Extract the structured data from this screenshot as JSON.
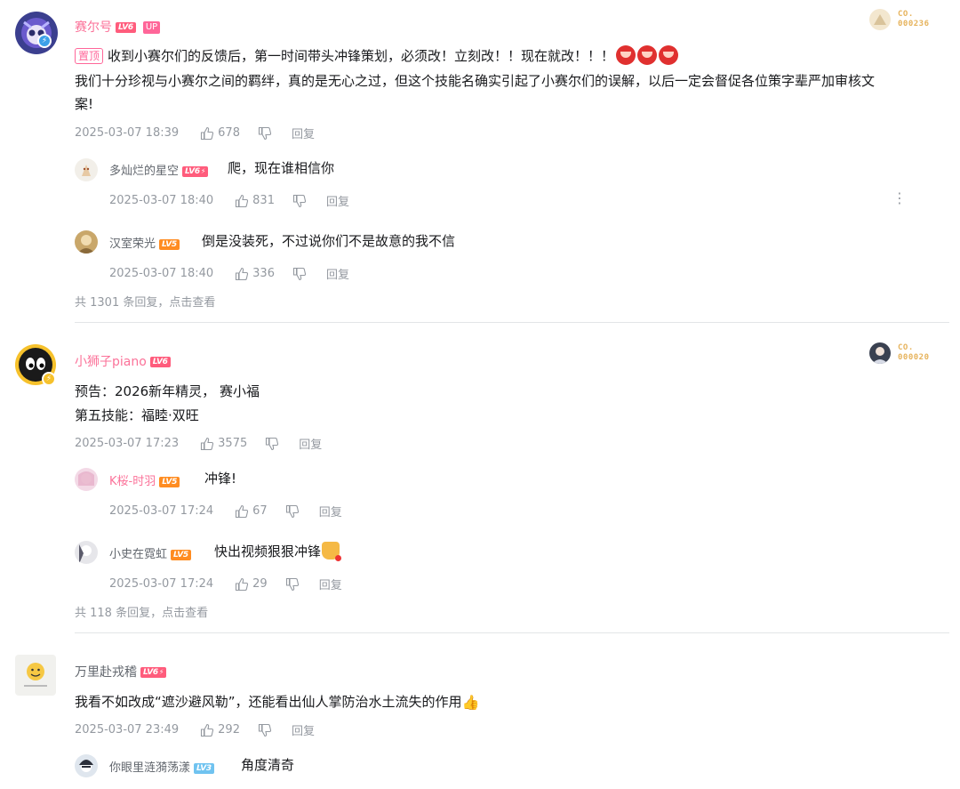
{
  "common": {
    "reply_label": "回复"
  },
  "threads": [
    {
      "user": "赛尔号",
      "level": "LV6",
      "up_label": "UP",
      "fan_badge": {
        "line1": "CO.",
        "line2": "000236"
      },
      "pin_label": "置顶",
      "content_line1": "收到小赛尔们的反馈后，第一时间带头冲锋策划，必须改！立刻改！！现在就改！！！",
      "content_line2": "我们十分珍视与小赛尔之间的羁绊，真的是无心之过，但这个技能名确实引起了小赛尔们的误解，以后一定会督促各位策字辈严加审核文案!",
      "time": "2025-03-07 18:39",
      "likes": "678",
      "replies": [
        {
          "user": "多灿烂的星空",
          "level": "LV6",
          "content": "爬，现在谁相信你",
          "time": "2025-03-07 18:40",
          "likes": "831"
        },
        {
          "user": "汉室荣光",
          "level": "LV5",
          "content": "倒是没装死，不过说你们不是故意的我不信",
          "time": "2025-03-07 18:40",
          "likes": "336"
        }
      ],
      "more_replies": "共 1301 条回复，点击查看"
    },
    {
      "user": "小狮子piano",
      "level": "LV6",
      "fan_badge": {
        "line1": "CO.",
        "line2": "000020"
      },
      "content_line1": "预告：2026新年精灵， 赛小福",
      "content_line2": "第五技能：福睦·双旺",
      "time": "2025-03-07 17:23",
      "likes": "3575",
      "replies": [
        {
          "user": "K桜-时羽",
          "level": "LV5",
          "content": "冲锋!",
          "time": "2025-03-07 17:24",
          "likes": "67"
        },
        {
          "user": "小史在霓虹",
          "level": "LV5",
          "content": "快出视频狠狠冲锋",
          "time": "2025-03-07 17:24",
          "likes": "29"
        }
      ],
      "more_replies": "共 118 条回复，点击查看"
    },
    {
      "user": "万里赴戎稽",
      "level": "LV6",
      "content_line1": "我看不如改成“遮沙避风勒”，还能看出仙人掌防治水土流失的作用",
      "time": "2025-03-07 23:49",
      "likes": "292",
      "replies": [
        {
          "user": "你眼里涟漪荡漾",
          "level": "LV3",
          "content": "角度清奇"
        }
      ]
    }
  ]
}
